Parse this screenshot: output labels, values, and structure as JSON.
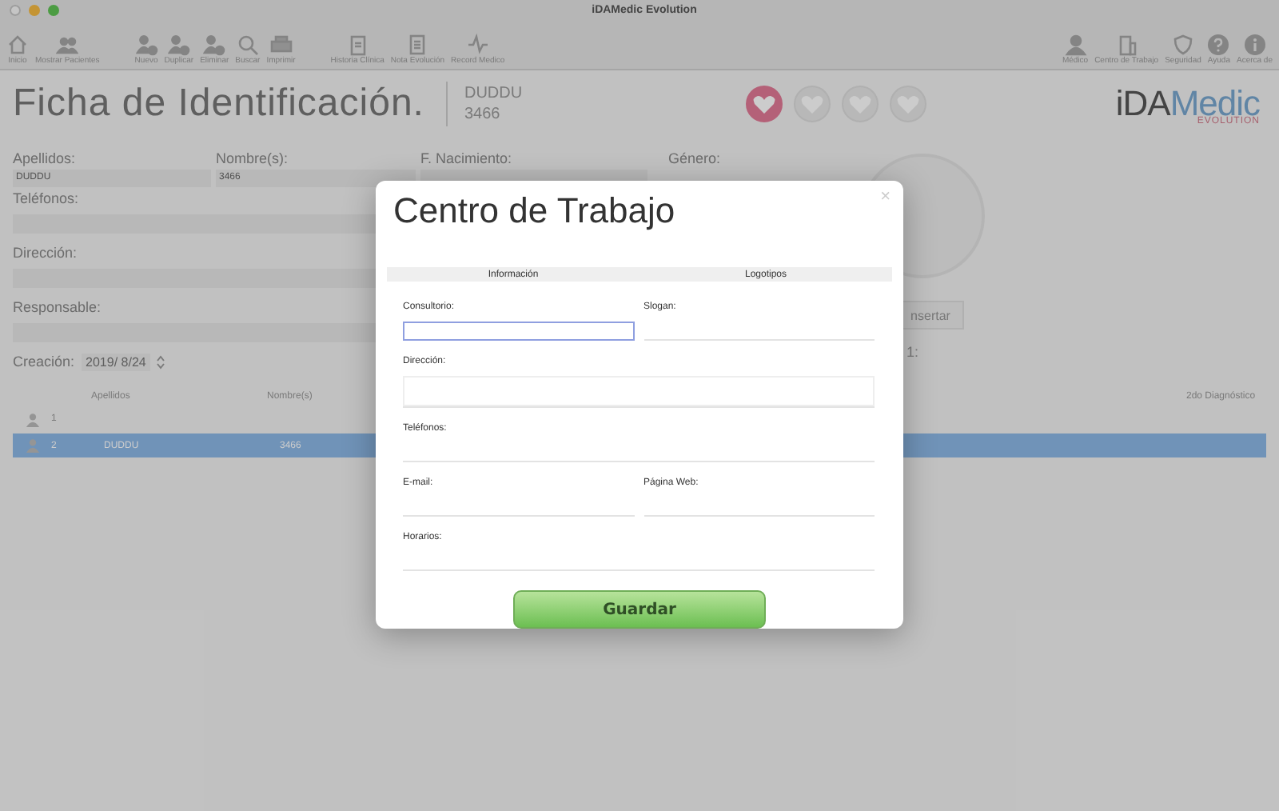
{
  "window": {
    "title": "iDAMedic Evolution"
  },
  "toolbar": {
    "left": [
      [
        {
          "label": "Inicio",
          "kind": "home"
        },
        {
          "label": "Mostrar Pacientes",
          "kind": "people"
        }
      ],
      [
        {
          "label": "Nuevo",
          "kind": "person-add"
        },
        {
          "label": "Duplicar",
          "kind": "person-check"
        },
        {
          "label": "Eliminar",
          "kind": "person-remove"
        },
        {
          "label": "Buscar",
          "kind": "search"
        },
        {
          "label": "Imprimir",
          "kind": "printer"
        }
      ],
      [
        {
          "label": "Historia Clínica",
          "kind": "clipboard"
        },
        {
          "label": "Nota Evolución",
          "kind": "document"
        },
        {
          "label": "Record Medico",
          "kind": "pulse"
        }
      ]
    ],
    "right": [
      {
        "label": "Médico",
        "kind": "person"
      },
      {
        "label": "Centro de Trabajo",
        "kind": "building"
      },
      {
        "label": "Seguridad",
        "kind": "shield"
      },
      {
        "label": "Ayuda",
        "kind": "help"
      },
      {
        "label": "Acerca de",
        "kind": "info"
      }
    ]
  },
  "header": {
    "title": "Ficha de Identificación.",
    "patient_name": "DUDDU",
    "patient_id": "3466",
    "hearts": [
      {
        "selected": true
      },
      {
        "selected": false
      },
      {
        "selected": false
      },
      {
        "selected": false
      }
    ],
    "logo": {
      "brand_a": "iDA",
      "brand_b": "Medic",
      "sub": "EVOLUTION"
    }
  },
  "form": {
    "top": [
      {
        "label": "Apellidos:",
        "value": "DUDDU"
      },
      {
        "label": "Nombre(s):",
        "value": "3466"
      },
      {
        "label": "F. Nacimiento:"
      }
    ],
    "gender_label": "Género:",
    "rows": [
      {
        "label": "Teléfonos:"
      },
      {
        "label": "Dirección:"
      },
      {
        "label": "Responsable:"
      }
    ],
    "creation_label": "Creación:",
    "creation_date": "2019/ 8/24",
    "insert_button": "nsertar",
    "counter": "1:"
  },
  "table": {
    "columns": [
      "Apellidos",
      "Nombre(s)",
      "2do Diagnóstico"
    ],
    "rows": [
      {
        "number": "1",
        "selected": false
      },
      {
        "number": "2",
        "apellidos": "DUDDU",
        "nombre": "3466",
        "selected": true
      }
    ]
  },
  "dialog": {
    "title": "Centro de Trabajo",
    "close": "×",
    "tabs": [
      "Información",
      "Logotipos"
    ],
    "fields": [
      {
        "label": "Consultorio:",
        "kind": "half",
        "focused": true
      },
      {
        "label": "Slogan:",
        "kind": "half",
        "focused": false
      },
      {
        "label": "Dirección:",
        "kind": "tall",
        "focused": false
      },
      {
        "label": "Teléfonos:",
        "kind": "full",
        "focused": false
      },
      {
        "label": "E-mail:",
        "kind": "half",
        "focused": false
      },
      {
        "label": "Página Web:",
        "kind": "half",
        "focused": false
      },
      {
        "label": "Horarios:",
        "kind": "full",
        "focused": false
      }
    ],
    "save_button": "Guardar"
  }
}
